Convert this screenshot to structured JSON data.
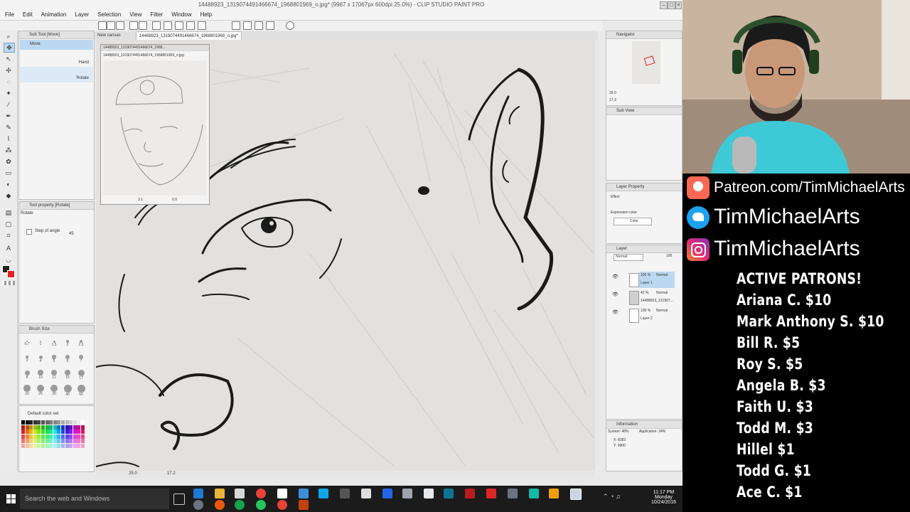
{
  "window": {
    "title": "14488923_1319074491466674_1968801969_o.jpg* (9967 x 17067px 600dpi 25.0%) - CLIP STUDIO PAINT PRO"
  },
  "menu": [
    "File",
    "Edit",
    "Animation",
    "Layer",
    "Selection",
    "View",
    "Filter",
    "Window",
    "Help"
  ],
  "doc_tabs": [
    "New canvas",
    "14488923_1319074491466674_1968801969_o.jpg*"
  ],
  "subtool": {
    "header": "Sub Tool [Move]",
    "items": [
      {
        "label": "Move",
        "selected": true
      },
      {
        "label": "Hand",
        "selected": false
      },
      {
        "label": "Rotate",
        "selected": false
      }
    ]
  },
  "tool_property": {
    "header": "Tool property [Rotate]",
    "name": "Rotate",
    "step_label": "Step of angle",
    "step_value": "45"
  },
  "brush_size": {
    "header": "Brush Size",
    "sizes": [
      "0.7",
      "1",
      "1.5",
      "2",
      "2.5",
      "3",
      "4",
      "5",
      "6",
      "7",
      "8",
      "10",
      "12",
      "15",
      "17",
      "20",
      "25",
      "30",
      "40",
      "50"
    ]
  },
  "color_set": {
    "label": "Default color set"
  },
  "navigator_float": {
    "title": "14488923_1319074491466674_1968...",
    "tab": "14488923_1319074491466674_1968801969_o.jpg",
    "zoom": "3.1",
    "angle": "0.0"
  },
  "navigator": {
    "header": "Navigator",
    "zoom": "25.0",
    "angle": "17.2"
  },
  "subview": {
    "header": "Sub View"
  },
  "layer_property": {
    "header": "Layer Property",
    "effect": "Effect",
    "expression_label": "Expression color",
    "expression_value": "Color"
  },
  "layers": {
    "header": "Layer",
    "blend": "Normal",
    "opacity": "100",
    "items": [
      {
        "pct": "100 %",
        "mode": "Normal",
        "name": "Layer 1",
        "selected": true
      },
      {
        "pct": "43 %",
        "mode": "Normal",
        "name": "14488923_131907...",
        "selected": false
      },
      {
        "pct": "100 %",
        "mode": "Normal",
        "name": "Layer 2",
        "selected": false
      }
    ]
  },
  "information": {
    "header": "Information",
    "system": "System: 48%",
    "application": "Application: 34%",
    "x": "X: 8382",
    "y": "Y: 9900"
  },
  "canvas_status": {
    "zoom": "25.0",
    "angle": "17.2"
  },
  "taskbar": {
    "search_placeholder": "Search the web and Windows",
    "time": "11:17 PM",
    "day": "Monday",
    "date": "10/24/2016"
  },
  "overlay": {
    "patreon": "Patreon.com/TimMichaelArts",
    "twitter": "TimMichaelArts",
    "instagram": "TimMichaelArts",
    "patrons_title": "ACTIVE PATRONS!",
    "patrons": [
      "Ariana C. $10",
      "Mark Anthony S. $10",
      "Bill R. $5",
      "Roy S. $5",
      "Angela B. $3",
      "Faith U. $3",
      "Todd M. $3",
      "Hillel $1",
      "Todd G. $1",
      "Ace C. $1"
    ]
  },
  "colors": {
    "patreon": "#f96854",
    "twitter": "#1da1f2",
    "instagram": "#c13584",
    "selection": "#bcd8f0",
    "taskbar": "#1b1b1b"
  }
}
